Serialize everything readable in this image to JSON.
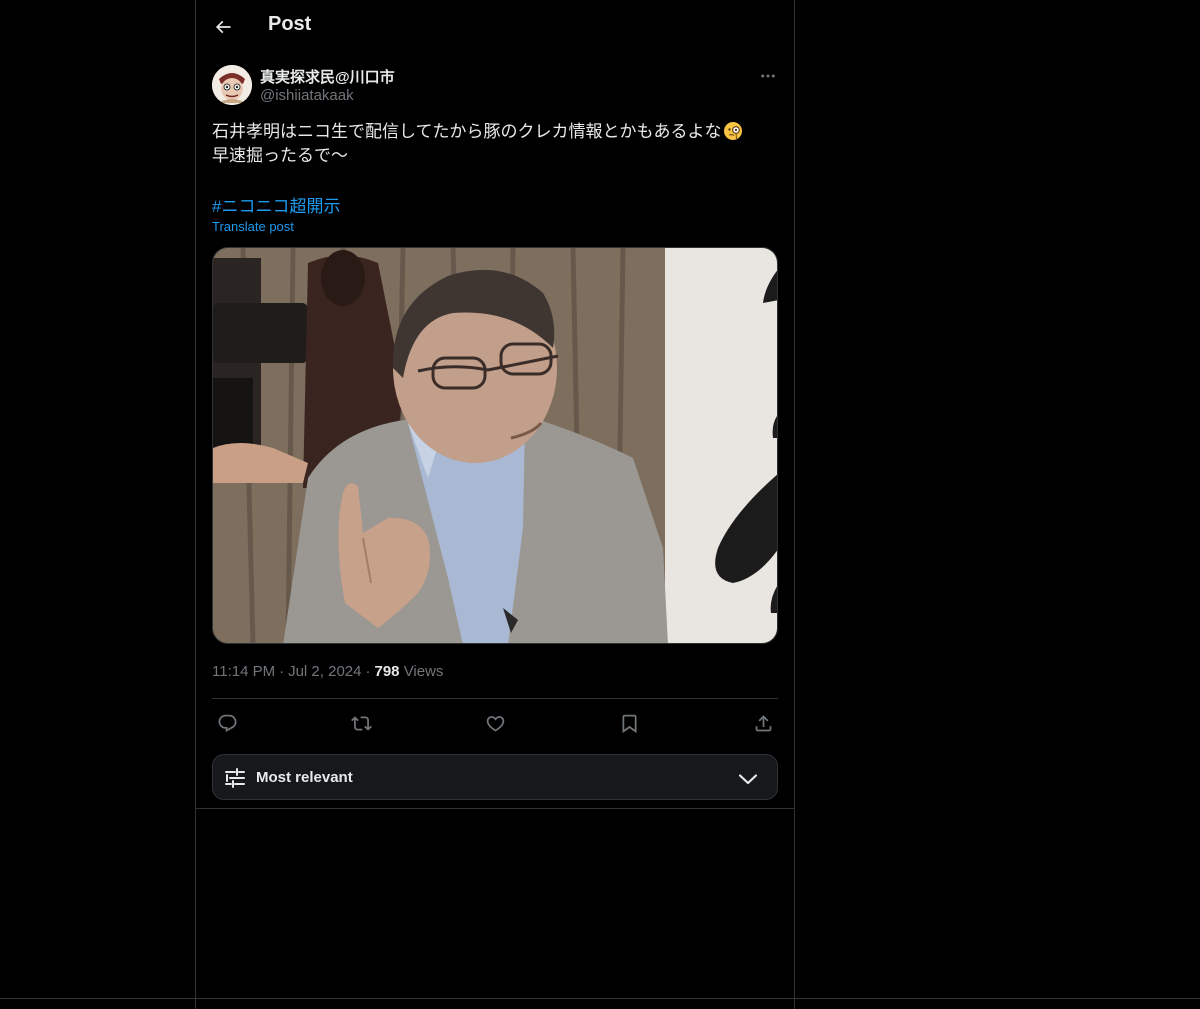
{
  "header": {
    "title": "Post"
  },
  "author": {
    "display_name": "真実探求民@川口市",
    "handle": "@ishiiatakaak"
  },
  "post": {
    "text_line_1": "石井孝明はニコ生で配信してたから豚のクレカ情報とかもあるよな",
    "text_line_2": "早速掘ったるで〜",
    "emoji": "face-with-monocle-emoji",
    "hashtag": "#ニコニコ超開示",
    "translate_label": "Translate post"
  },
  "meta": {
    "time": "11:14 PM",
    "separator": "·",
    "date": "Jul 2, 2024",
    "views_count": "798",
    "views_label": "Views"
  },
  "actions": [
    "reply-icon",
    "repost-icon",
    "like-icon",
    "bookmark-icon",
    "share-icon"
  ],
  "sort": {
    "label": "Most relevant"
  },
  "colors": {
    "background": "#000000",
    "text": "#e7e9ea",
    "muted": "#71767b",
    "accent": "#1d9bf0",
    "border": "#2f3336",
    "sort_bar": "#16181c"
  }
}
